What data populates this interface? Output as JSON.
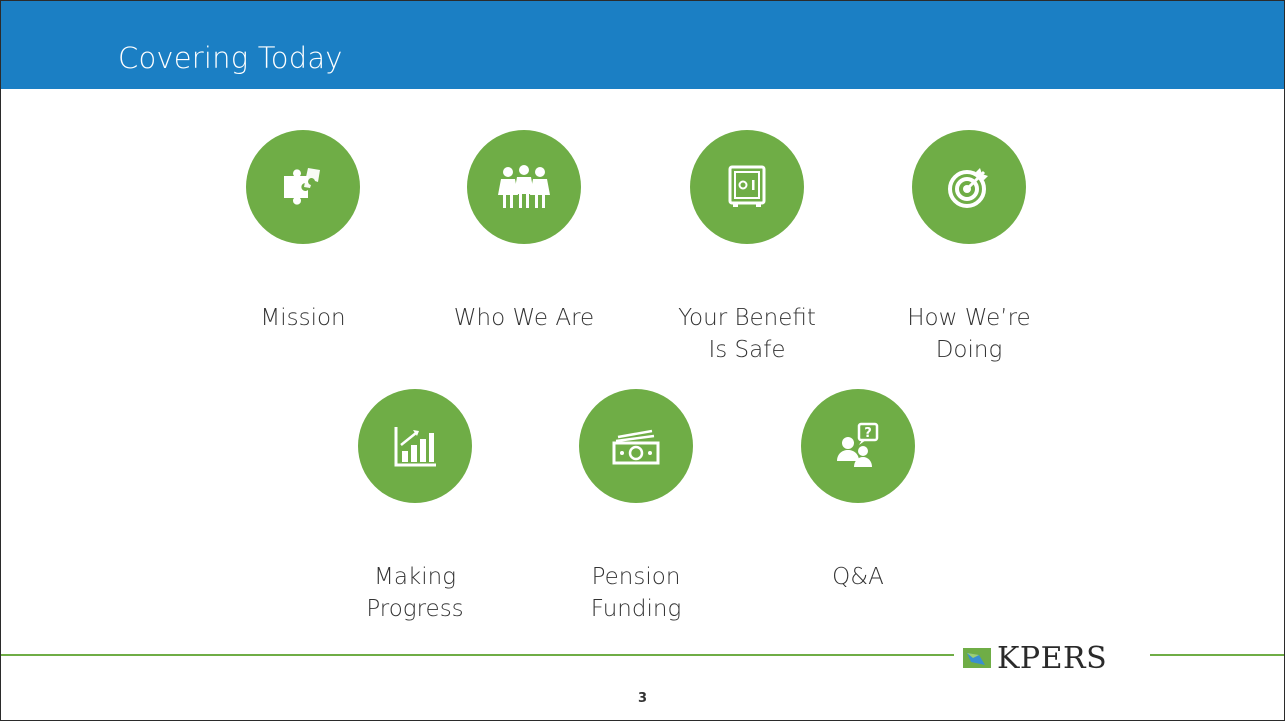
{
  "header": {
    "title": "Covering Today"
  },
  "items": [
    {
      "icon": "puzzle-icon",
      "lines": [
        "Mission",
        ""
      ]
    },
    {
      "icon": "people-group-icon",
      "lines": [
        "Who We Are",
        ""
      ]
    },
    {
      "icon": "safe-icon",
      "lines": [
        "Your Benefit",
        "Is Safe"
      ]
    },
    {
      "icon": "target-icon",
      "lines": [
        "How We’re",
        "Doing"
      ]
    },
    {
      "icon": "bar-chart-icon",
      "lines": [
        "Making",
        "Progress"
      ]
    },
    {
      "icon": "money-icon",
      "lines": [
        "Pension",
        "Funding"
      ]
    },
    {
      "icon": "question-person-icon",
      "lines": [
        "Q&A",
        ""
      ]
    }
  ],
  "footer": {
    "logo_text": "KPERS",
    "page_number": "3"
  },
  "colors": {
    "header_blue": "#1b7fc4",
    "accent_green": "#6fad46"
  }
}
